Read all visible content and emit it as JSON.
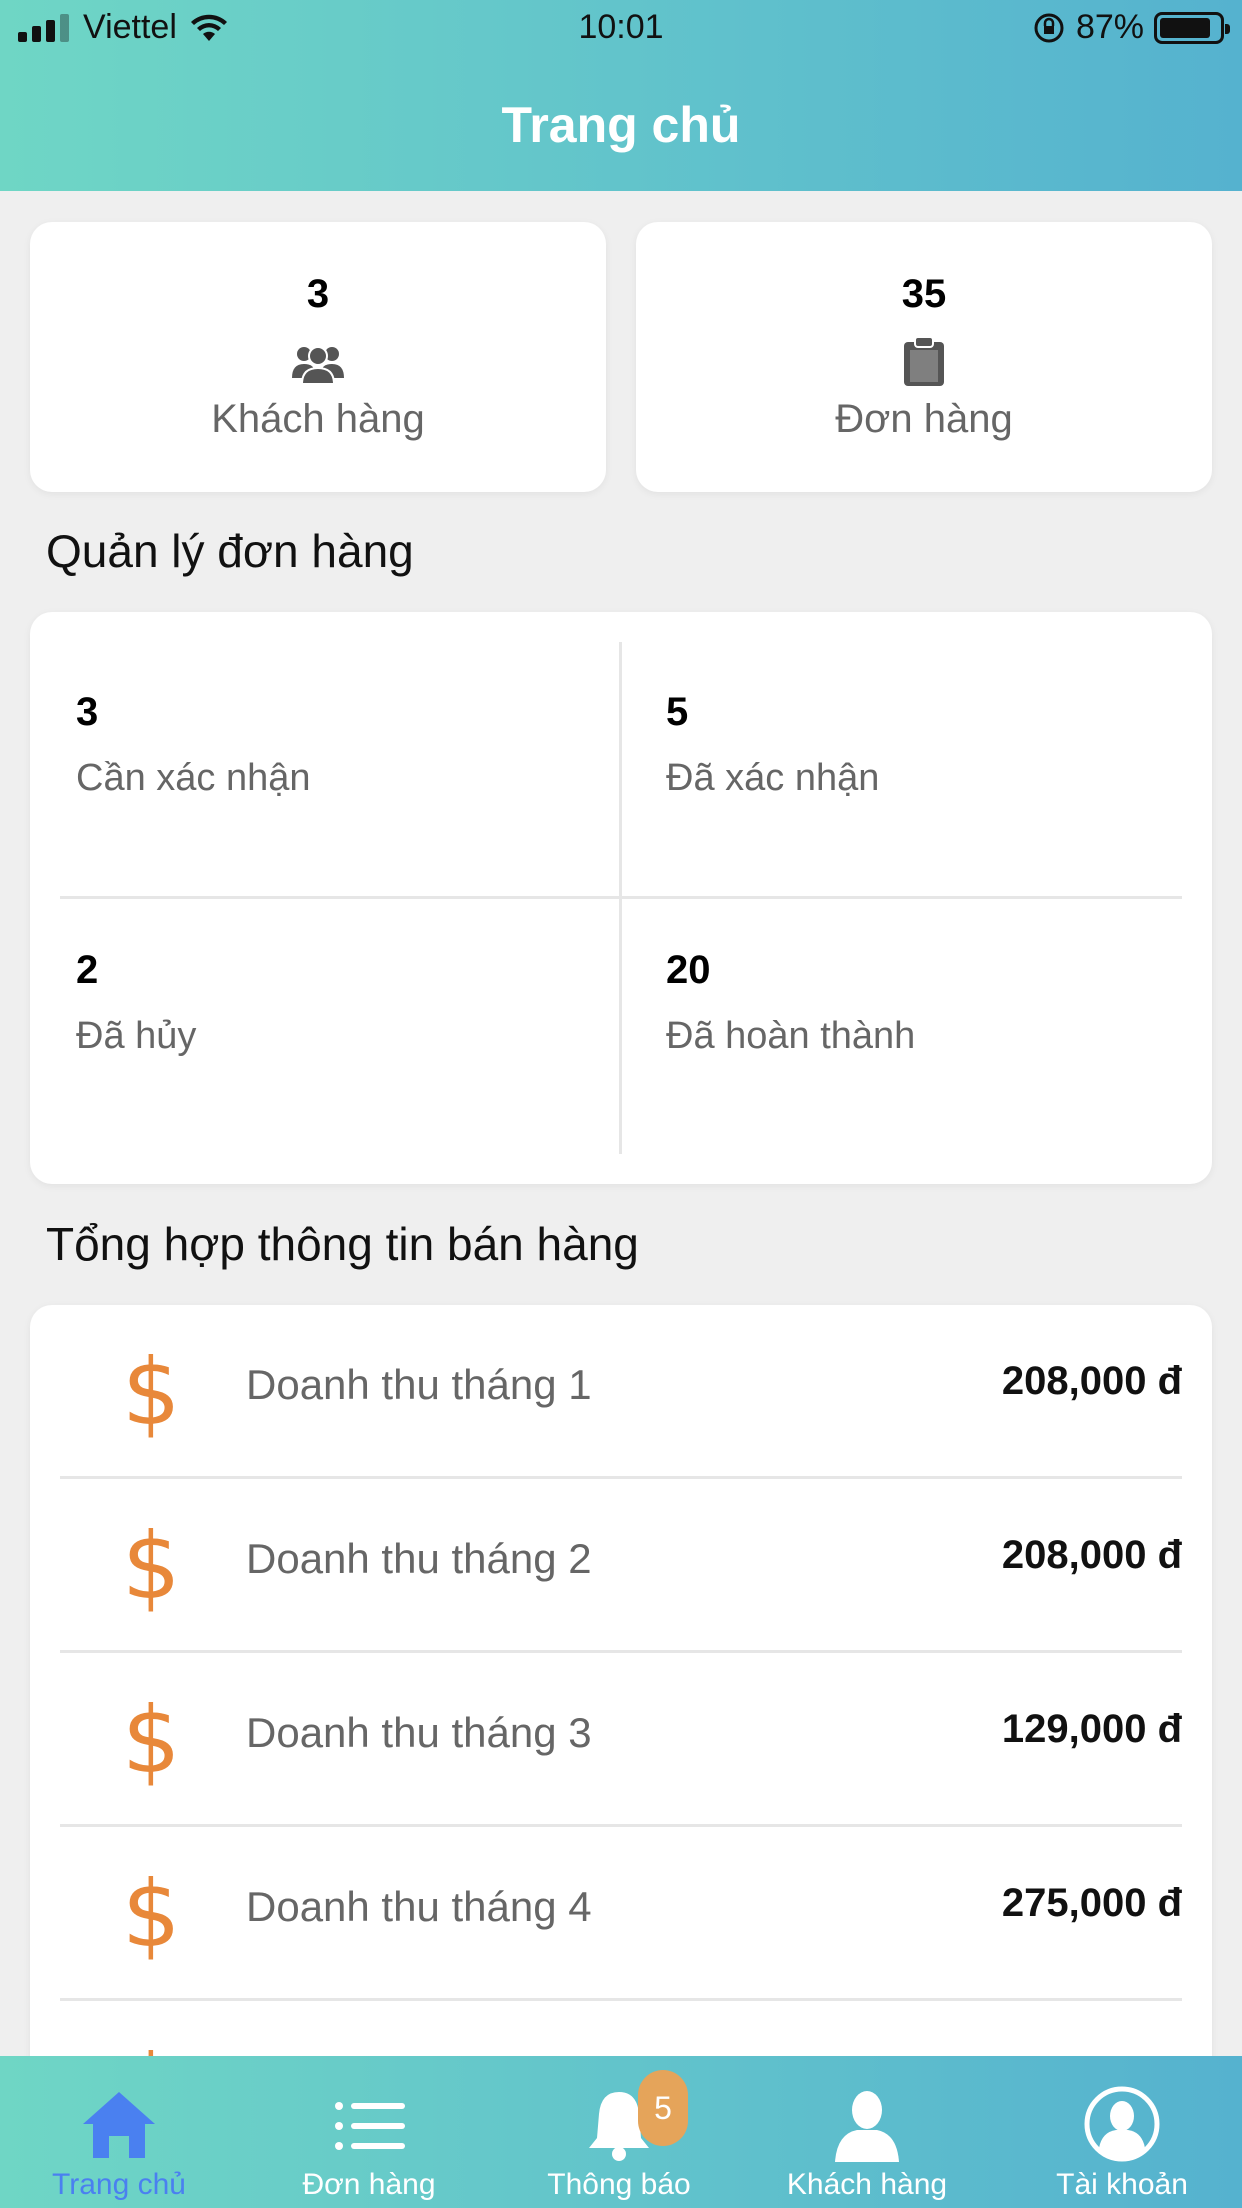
{
  "status_bar": {
    "carrier": "Viettel",
    "time": "10:01",
    "battery": "87%",
    "battery_level": 0.87
  },
  "header": {
    "title": "Trang chủ"
  },
  "summary": [
    {
      "count": "3",
      "label": "Khách hàng",
      "icon": "customers-icon"
    },
    {
      "count": "35",
      "label": "Đơn hàng",
      "icon": "clipboard-icon"
    }
  ],
  "order_management": {
    "title": "Quản lý đơn hàng",
    "items": [
      {
        "count": "3",
        "label": "Cần xác nhận"
      },
      {
        "count": "5",
        "label": "Đã xác nhận"
      },
      {
        "count": "2",
        "label": "Đã hủy"
      },
      {
        "count": "20",
        "label": "Đã hoàn thành"
      }
    ]
  },
  "sales_summary": {
    "title": "Tổng hợp thông tin bán hàng",
    "icon": "dollar-icon",
    "rows": [
      {
        "label": "Doanh thu tháng 1",
        "value": "208,000 đ"
      },
      {
        "label": "Doanh thu tháng 2",
        "value": "208,000 đ"
      },
      {
        "label": "Doanh thu tháng 3",
        "value": "129,000 đ"
      },
      {
        "label": "Doanh thu tháng 4",
        "value": "275,000 đ"
      }
    ]
  },
  "tabbar": {
    "items": [
      {
        "label": "Trang chủ",
        "icon": "home-icon",
        "active": true
      },
      {
        "label": "Đơn hàng",
        "icon": "list-icon"
      },
      {
        "label": "Thông báo",
        "icon": "bell-icon",
        "badge": "5"
      },
      {
        "label": "Khách hàng",
        "icon": "person-icon"
      },
      {
        "label": "Tài khoản",
        "icon": "account-icon"
      }
    ]
  },
  "colors": {
    "accent_orange": "#e8883a",
    "active_tab": "#4a80f0",
    "badge": "#e5a45a",
    "header_start": "#6fd6c5",
    "header_end": "#55b2cf"
  }
}
